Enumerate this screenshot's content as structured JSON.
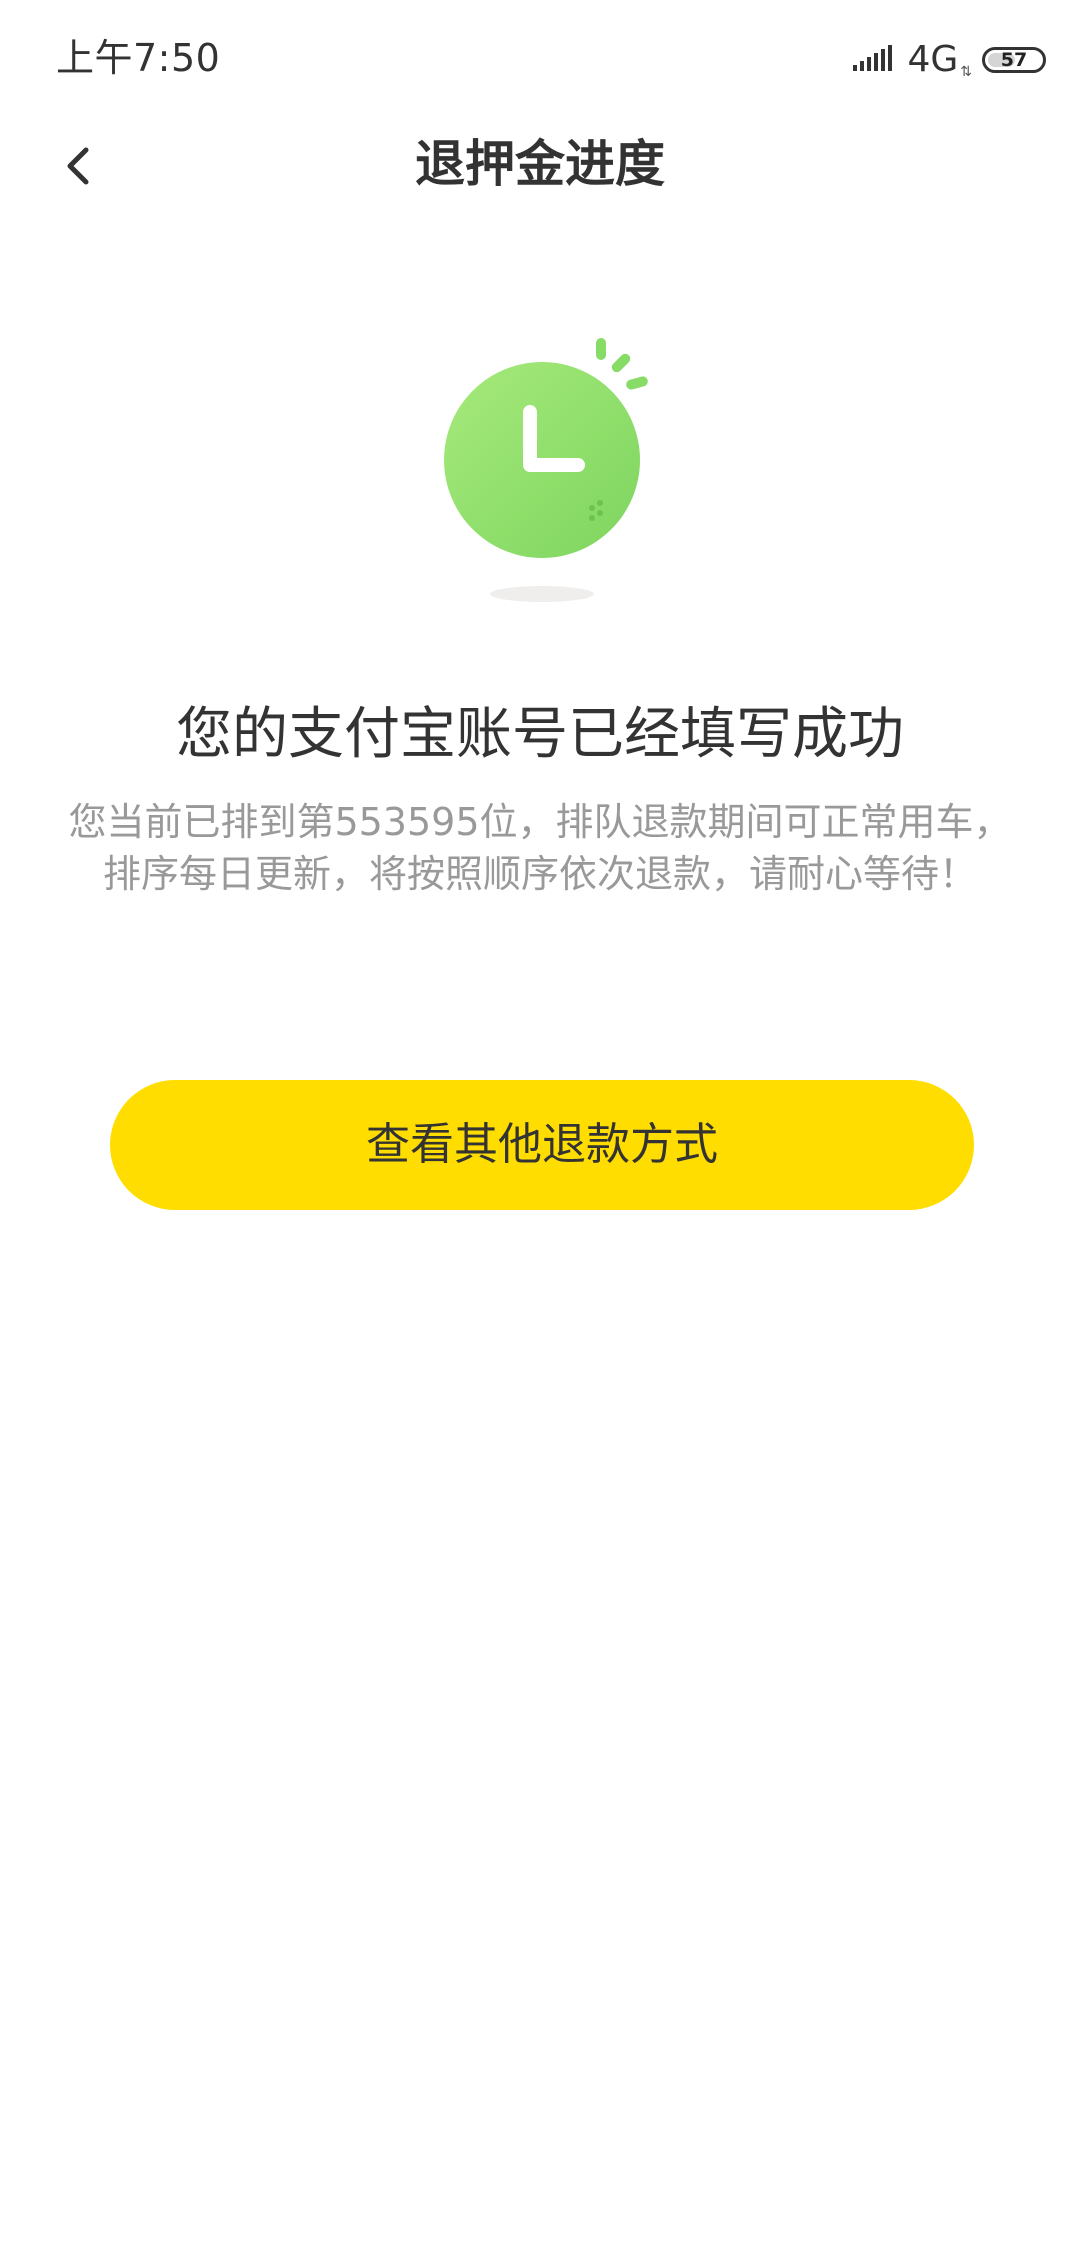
{
  "status_bar": {
    "time": "上午7:50",
    "network": "4G",
    "battery": "57",
    "battery_level": 0.57,
    "icons": [
      "signal-icon",
      "network-activity-icon",
      "battery-icon"
    ]
  },
  "nav": {
    "title": "退押金进度",
    "back_icon": "chevron-left-icon"
  },
  "illustration": {
    "icon": "clock-icon",
    "colors": {
      "clock_light": "#a3e878",
      "clock_dark": "#7dd55e",
      "hand": "#ffffff",
      "shadow": "#eeeeee"
    }
  },
  "message": {
    "title": "您的支付宝账号已经填写成功",
    "line1": "您当前已排到第553595位，排队退款期间可正常用车，",
    "line2": "排序每日更新，将按照顺序依次退款，请耐心等待！"
  },
  "actions": {
    "other_refund_label": "查看其他退款方式",
    "button_color": "#ffdd00"
  }
}
